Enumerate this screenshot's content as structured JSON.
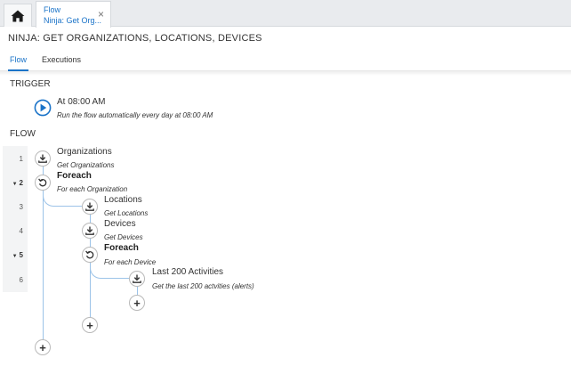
{
  "tabs": {
    "home_icon": "home-icon",
    "active_tab": {
      "title": "Flow",
      "subtitle": "Ninja: Get Org...",
      "close": "×"
    }
  },
  "page": {
    "title": "NINJA: GET ORGANIZATIONS, LOCATIONS, DEVICES"
  },
  "subtabs": [
    {
      "label": "Flow",
      "active": true
    },
    {
      "label": "Executions",
      "active": false
    }
  ],
  "trigger": {
    "heading": "TRIGGER",
    "title": "At 08:00 AM",
    "description": "Run the flow automatically every day at 08:00 AM"
  },
  "flow": {
    "heading": "FLOW",
    "line_numbers": [
      "1",
      "2",
      "3",
      "4",
      "5",
      "6"
    ],
    "steps": [
      {
        "line": "1",
        "icon": "download-icon",
        "title": "Organizations",
        "description": "Get Organizations"
      },
      {
        "line": "2",
        "icon": "loop-icon",
        "title": "Foreach",
        "description": "For each Organization"
      },
      {
        "line": "3",
        "icon": "download-icon",
        "title": "Locations",
        "description": "Get Locations"
      },
      {
        "line": "4",
        "icon": "download-icon",
        "title": "Devices",
        "description": "Get Devices"
      },
      {
        "line": "5",
        "icon": "loop-icon",
        "title": "Foreach",
        "description": "For each Device"
      },
      {
        "line": "6",
        "icon": "download-icon",
        "title": "Last 200 Activities",
        "description": "Get the last 200 actvities (alerts)"
      }
    ],
    "add_label": "+"
  },
  "colors": {
    "accent": "#1a73c8",
    "connector": "#9cc3e8"
  }
}
